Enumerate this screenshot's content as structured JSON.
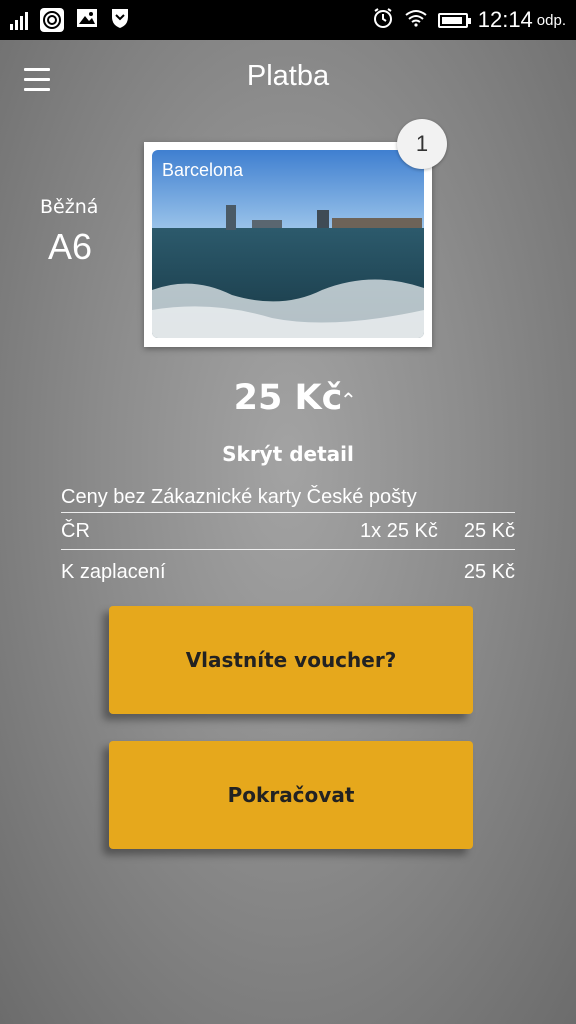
{
  "status": {
    "time": "12:14",
    "suffix": "odp."
  },
  "header": {
    "title": "Platba",
    "menu_icon": "hamburger-menu-icon"
  },
  "product": {
    "type": "Běžná",
    "format": "A6",
    "photo_label": "Barcelona",
    "count": "1"
  },
  "price": {
    "amount": "25 Kč",
    "toggle_label": "Skrýt detail"
  },
  "detail": {
    "header": "Ceny bez Zákaznické karty České pošty",
    "rows": [
      {
        "label": "ČR",
        "qty": "1x 25 Kč",
        "total": "25 Kč"
      }
    ],
    "to_pay": {
      "label": "K zaplacení",
      "total": "25 Kč"
    }
  },
  "buttons": {
    "voucher": "Vlastníte voucher?",
    "continue": "Pokračovat"
  },
  "colors": {
    "accent": "#e6a81c",
    "background": "#8c8c8c",
    "statusbar": "#000000"
  }
}
